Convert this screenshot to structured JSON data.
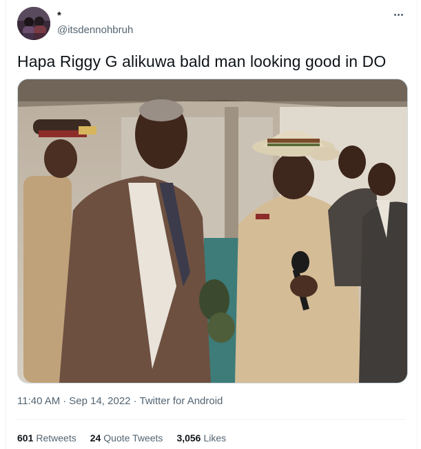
{
  "tweet": {
    "display_name": "*",
    "handle": "@itsdennohbruh",
    "text": "Hapa Riggy G alikuwa bald man looking good in DO",
    "timestamp": "11:40 AM",
    "date": "Sep 14, 2022",
    "separator": "·",
    "source": "Twitter for Android",
    "media_alt_icon": "photo"
  },
  "stats": [
    {
      "value": "601",
      "label": "Retweets"
    },
    {
      "value": "24",
      "label": "Quote Tweets"
    },
    {
      "value": "3,056",
      "label": "Likes"
    }
  ],
  "icons": {
    "more": "more-icon",
    "avatar": "avatar-image"
  },
  "colors": {
    "text_primary": "#0f1419",
    "text_secondary": "#536471",
    "border": "#eff3f4"
  }
}
